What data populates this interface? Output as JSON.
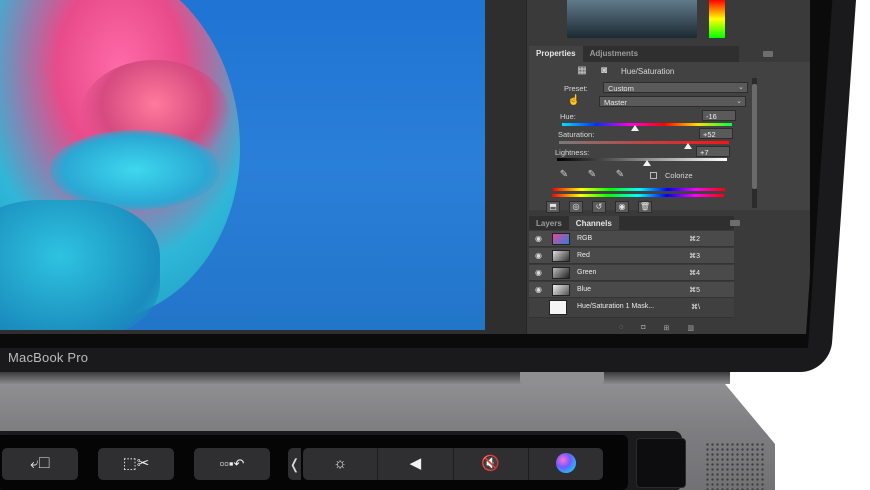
{
  "device": {
    "brand_label": "MacBook Pro"
  },
  "photoshop": {
    "properties_panel": {
      "tabs": [
        "Properties",
        "Adjustments"
      ],
      "adjustment_title": "Hue/Saturation",
      "preset_label": "Preset:",
      "preset_value": "Custom",
      "channel_value": "Master",
      "hue": {
        "label": "Hue:",
        "value": "-16",
        "knob_fraction": 0.43
      },
      "saturation": {
        "label": "Saturation:",
        "value": "+52",
        "knob_fraction": 0.76
      },
      "lightness": {
        "label": "Lightness:",
        "value": "+7",
        "knob_fraction": 0.53
      },
      "colorize_label": "Colorize"
    },
    "channels_panel": {
      "tabs": [
        "Layers",
        "Channels"
      ],
      "rows": [
        {
          "name": "RGB",
          "shortcut": "⌘2",
          "thumb_color": "#3a6fd0"
        },
        {
          "name": "Red",
          "shortcut": "⌘3",
          "thumb_color": "#9a9a9a"
        },
        {
          "name": "Green",
          "shortcut": "⌘4",
          "thumb_color": "#7d7d7d"
        },
        {
          "name": "Blue",
          "shortcut": "⌘5",
          "thumb_color": "#b5b5b5"
        },
        {
          "name": "Hue/Saturation 1 Mask...",
          "shortcut": "⌘\\",
          "thumb_color": "#f5f5f5"
        }
      ]
    }
  },
  "touchbar": {
    "colors": {
      "key": "#2f2f31",
      "bar": "#050505"
    },
    "keys": [
      {
        "icon": "screen-mode-icon"
      },
      {
        "icon": "scissors-select-icon"
      },
      {
        "icon": "undo-history-icon"
      }
    ],
    "control_strip": [
      "brightness-icon",
      "volume-down-icon",
      "mute-icon",
      "siri-icon"
    ]
  }
}
